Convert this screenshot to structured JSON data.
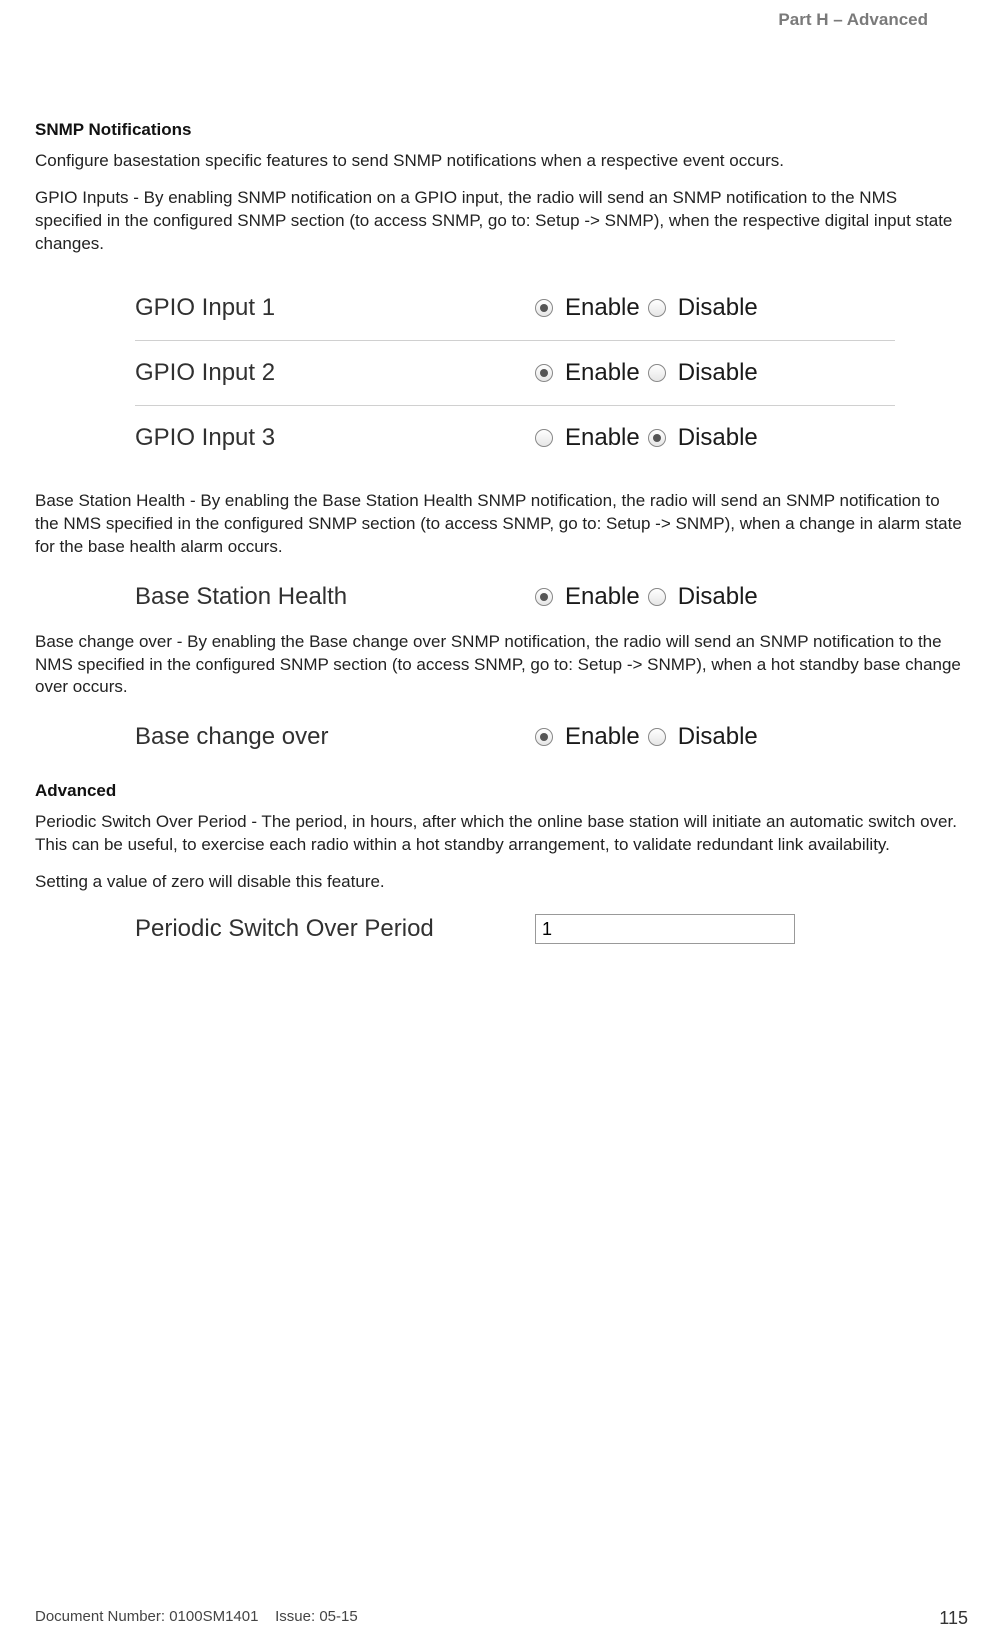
{
  "header": {
    "part": "Part H – Advanced"
  },
  "snmp": {
    "heading": "SNMP Notifications",
    "intro": "Configure basestation specific features to send SNMP notifications when a respective event occurs.",
    "gpio_text": "GPIO Inputs - By enabling SNMP notification on a GPIO input, the radio will send an SNMP notification to the NMS specified in the configured SNMP section (to access SNMP, go to: Setup -> SNMP), when the respective digital input state changes.",
    "gpio_rows": [
      {
        "label": "GPIO Input 1",
        "selected": "enable"
      },
      {
        "label": "GPIO Input 2",
        "selected": "enable"
      },
      {
        "label": "GPIO Input 3",
        "selected": "disable"
      }
    ],
    "enable_label": "Enable",
    "disable_label": "Disable",
    "bsh_text": "Base Station Health - By enabling the Base Station Health SNMP notification, the radio will send an SNMP notification to the NMS specified in the configured SNMP section (to access SNMP, go to: Setup -> SNMP), when a change in alarm state for the base health alarm occurs.",
    "bsh_row": {
      "label": "Base Station Health",
      "selected": "enable"
    },
    "bco_text": "Base change over - By enabling the Base change over SNMP notification, the radio will send an SNMP notification to the NMS specified in the configured SNMP section (to access SNMP, go to: Setup -> SNMP), when a hot standby base change over occurs.",
    "bco_row": {
      "label": "Base change over",
      "selected": "enable"
    }
  },
  "advanced": {
    "heading": "Advanced",
    "p1": "Periodic Switch Over Period - The period, in hours, after which the online base station will initiate an automatic switch over. This can be useful, to exercise each radio within a hot standby arrangement, to validate redundant link availability.",
    "p2": "Setting a value of zero will disable this feature.",
    "row": {
      "label": "Periodic Switch Over Period",
      "value": "1"
    }
  },
  "footer": {
    "doc": "Document Number: 0100SM1401",
    "issue": "Issue: 05-15",
    "page": "115"
  }
}
